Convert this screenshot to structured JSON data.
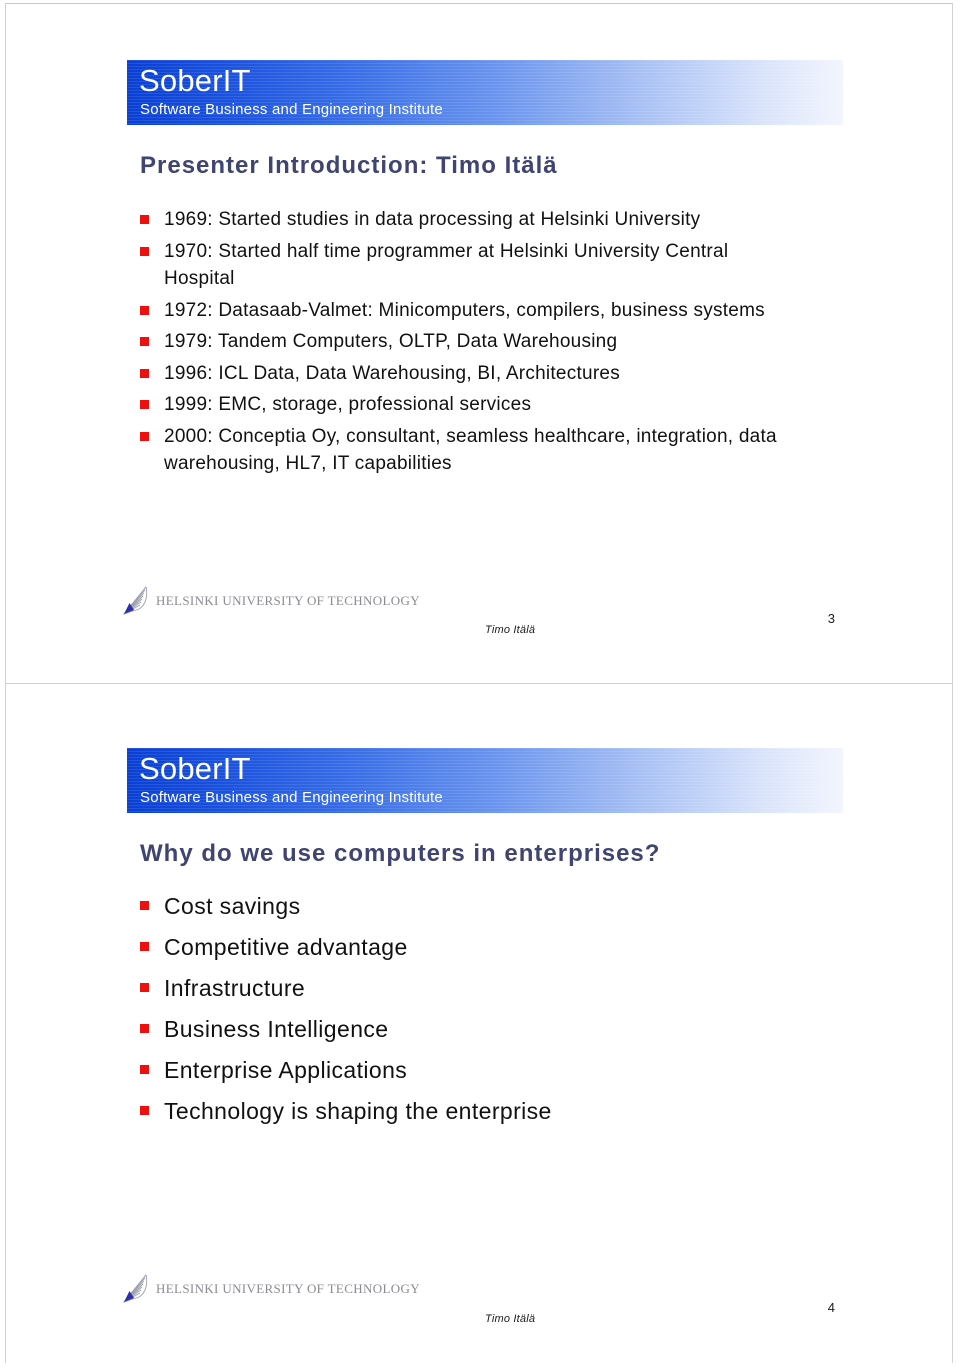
{
  "document": {
    "type": "presentation-handout",
    "slide_count": 2
  },
  "brand": {
    "banner_title": "SoberIT",
    "banner_subtitle": "Software Business and Engineering Institute",
    "banner_gradient_start": "#0a3fd4",
    "banner_gradient_end": "#f2f5fe",
    "title_color": "#3f4470",
    "bullet_color": "#ee0f0f"
  },
  "footer": {
    "organization": "HELSINKI UNIVERSITY OF TECHNOLOGY",
    "author": "Timo Itälä",
    "logo_icon": "tkk-fan-logo-icon"
  },
  "slides": [
    {
      "number": "3",
      "title": "Presenter Introduction: Timo Itälä",
      "bullets": [
        "1969: Started studies in data processing at Helsinki University",
        "1970: Started half time programmer at Helsinki University Central Hospital",
        "1972: Datasaab-Valmet: Minicomputers, compilers, business systems",
        "1979: Tandem Computers, OLTP, Data Warehousing",
        "1996: ICL Data, Data Warehousing, BI, Architectures",
        "1999: EMC, storage, professional services",
        "2000: Conceptia Oy, consultant, seamless healthcare, integration, data warehousing, HL7, IT capabilities"
      ]
    },
    {
      "number": "4",
      "title": "Why do we use computers in enterprises?",
      "bullets": [
        "Cost savings",
        "Competitive advantage",
        "Infrastructure",
        "Business Intelligence",
        "Enterprise Applications",
        "Technology is shaping the enterprise"
      ]
    }
  ]
}
